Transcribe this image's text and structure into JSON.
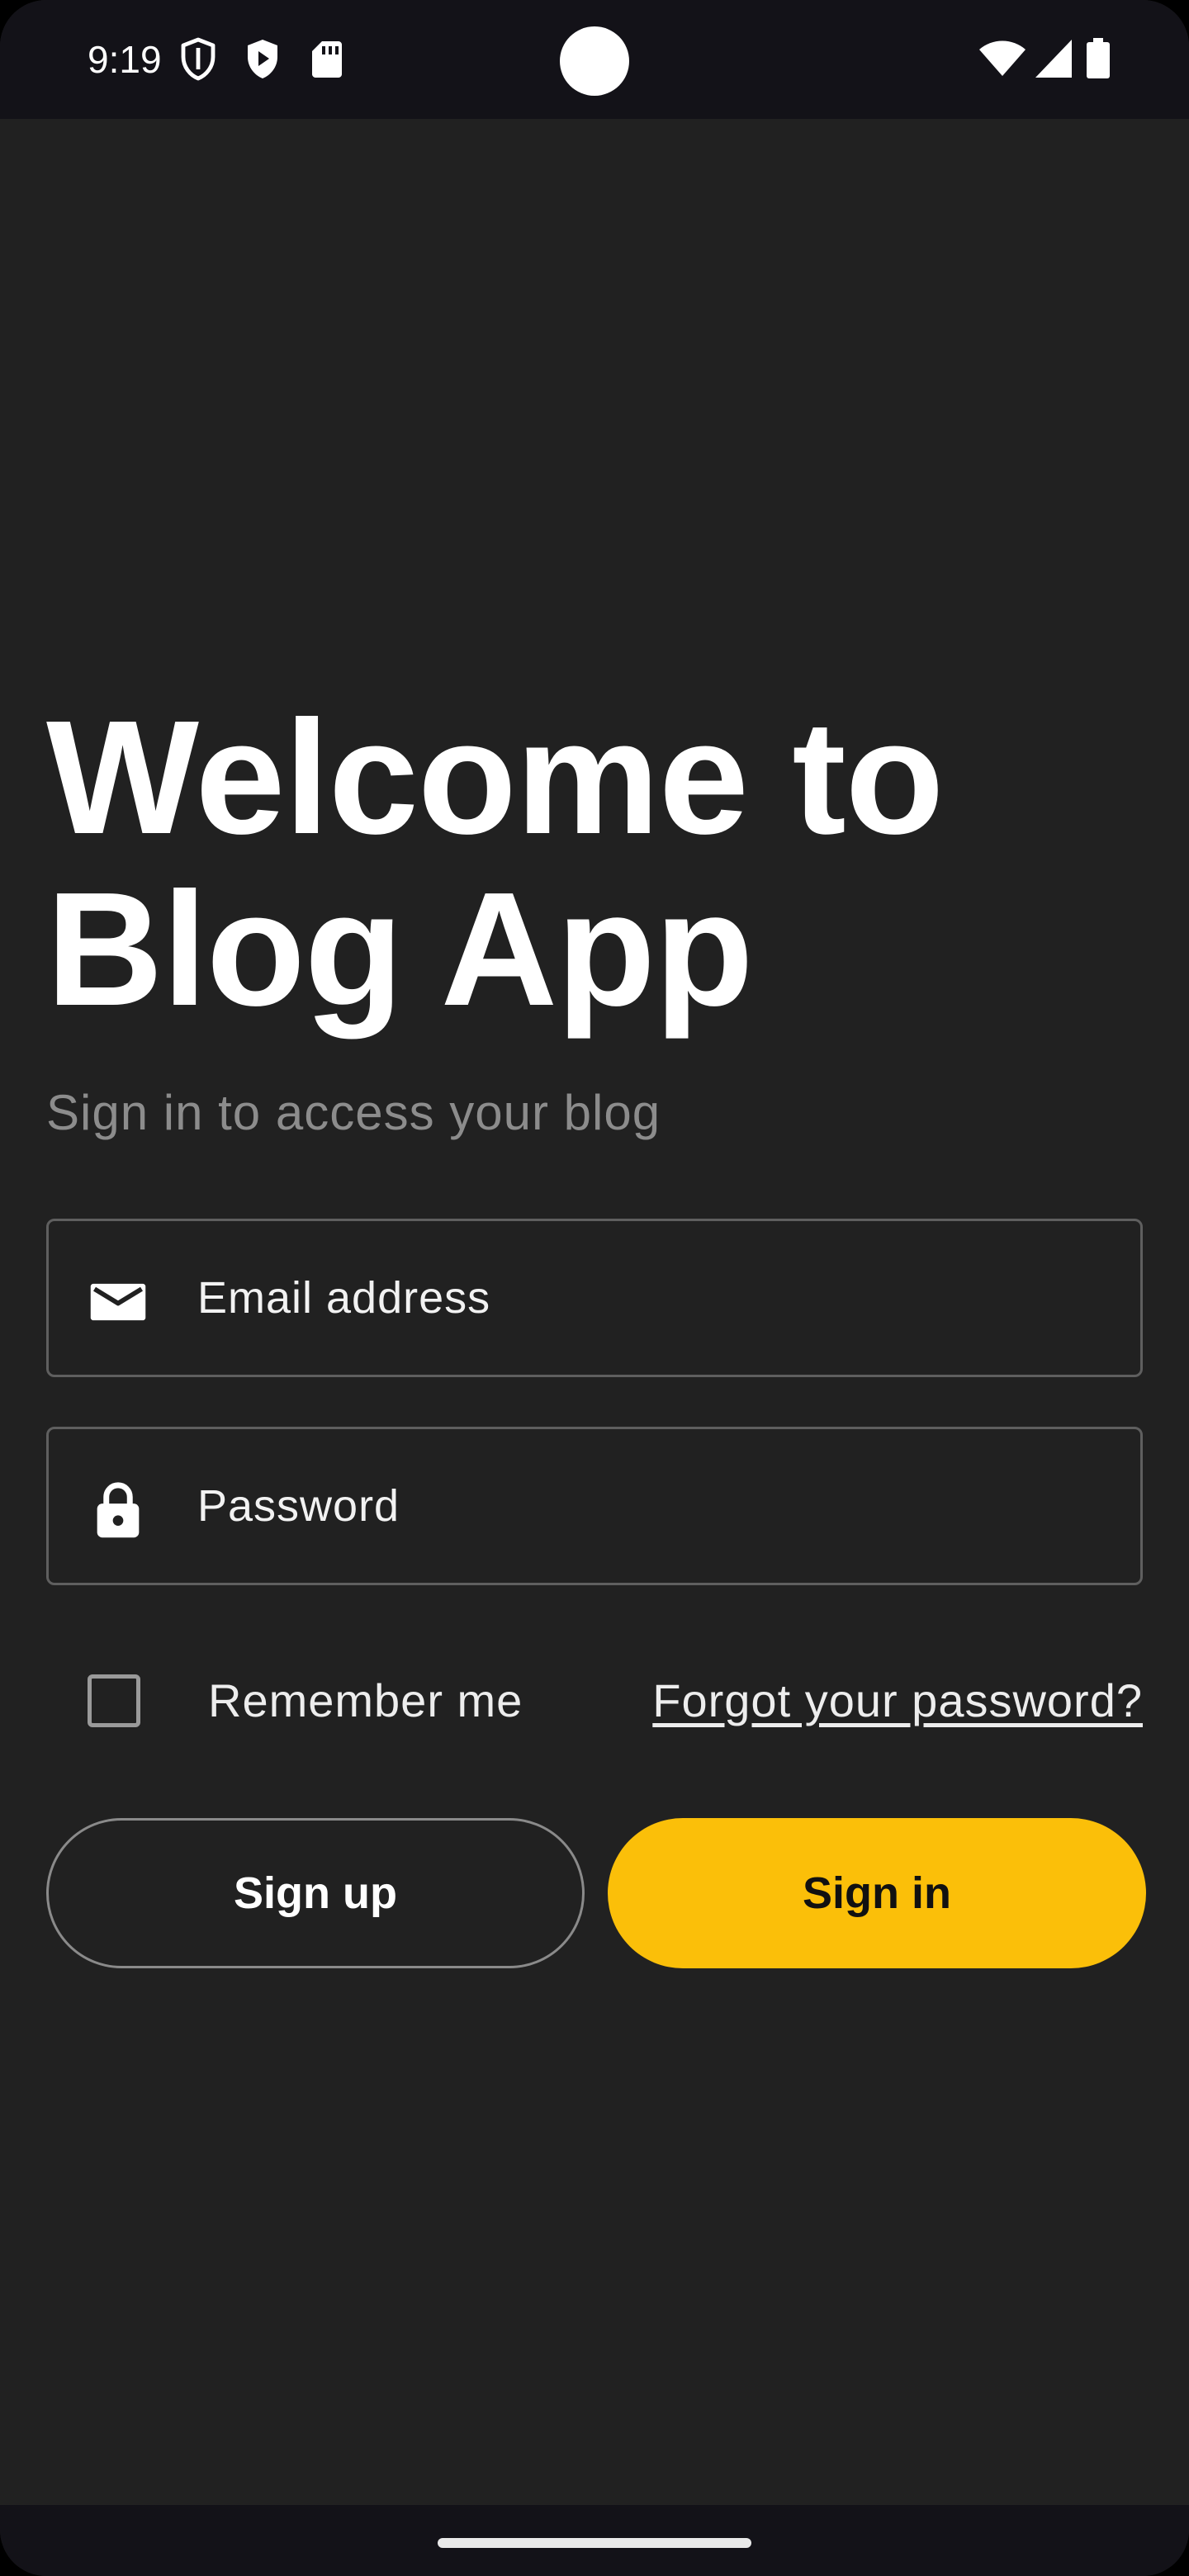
{
  "status_bar": {
    "time": "9:19",
    "left_icons": [
      "shield-icon",
      "play-protect-icon",
      "sd-card-icon"
    ],
    "right_icons": [
      "wifi-icon",
      "cell-signal-icon",
      "battery-icon"
    ]
  },
  "login": {
    "title": "Welcome to Blog App",
    "subtitle": "Sign in to access your blog",
    "email": {
      "icon": "mail-icon",
      "placeholder": "Email address",
      "value": ""
    },
    "password": {
      "icon": "lock-icon",
      "placeholder": "Password",
      "value": ""
    },
    "remember_me": {
      "label": "Remember me",
      "checked": false
    },
    "forgot_password_label": "Forgot your password?",
    "signup_label": "Sign up",
    "signin_label": "Sign in"
  },
  "colors": {
    "background": "#212121",
    "status_bar": "#131218",
    "accent": "#fbbf09",
    "subtitle_text": "#8c8c8c",
    "field_border": "#5f5f5f"
  }
}
